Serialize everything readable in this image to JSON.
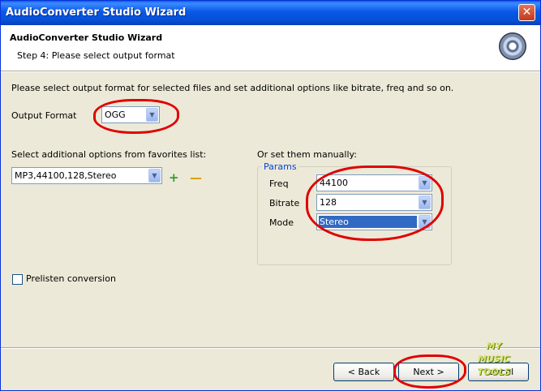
{
  "window": {
    "title": "AudioConverter Studio Wizard",
    "close_symbol": "✕"
  },
  "header": {
    "title": "AudioConverter Studio Wizard",
    "step": "Step 4: Please select output format"
  },
  "intro_text": "Please select output format for selected files and set additional options like bitrate, freq and so on.",
  "output_format": {
    "label": "Output Format",
    "value": "OGG"
  },
  "favorites": {
    "label": "Select additional options from favorites list:",
    "value": "MP3,44100,128,Stereo",
    "add_symbol": "+",
    "remove_symbol": "—"
  },
  "manual": {
    "label": "Or set them manually:",
    "group": "Params",
    "freq": {
      "label": "Freq",
      "value": "44100"
    },
    "bitrate": {
      "label": "Bitrate",
      "value": "128"
    },
    "mode": {
      "label": "Mode",
      "value": "Stereo"
    }
  },
  "prelisten": {
    "label": "Prelisten conversion",
    "checked": false
  },
  "buttons": {
    "back": "< Back",
    "next": "Next >",
    "cancel": "Cancel"
  },
  "watermark": {
    "line1": "MY",
    "line2": "MUSIC",
    "line3": "TOOLS"
  },
  "colors": {
    "annotation": "#e00000",
    "titlebar": "#0858e8",
    "selection": "#316ac5"
  }
}
